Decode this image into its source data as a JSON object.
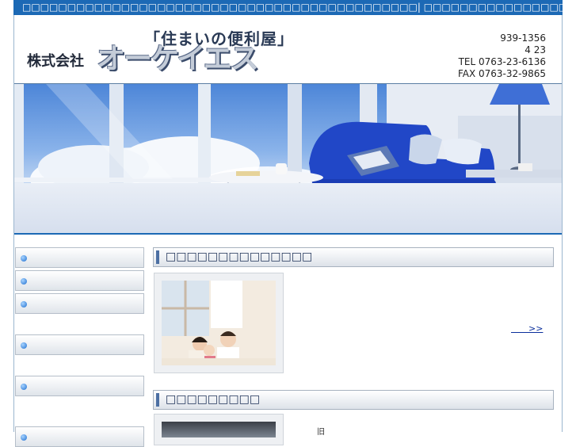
{
  "topbar": {
    "text": "□□□□□□□□□□□□□□□□□□□□□□□□□□□□□□□□□□□□□□□□□□□□| □□□□□□□□□□□□□□□□□□□□□□□□□□□□□"
  },
  "header": {
    "tagline": "「住まいの便利屋」",
    "company_prefix": "株式会社",
    "company_name": "オーケイエス",
    "contact": {
      "postal": "939-1356",
      "address_num": "4 23",
      "tel": "TEL 0763-23-6136",
      "fax": "FAX 0763-32-9865"
    }
  },
  "sidebar": {
    "items": [
      {
        "label": ""
      },
      {
        "label": ""
      },
      {
        "label": ""
      },
      {
        "label": ""
      },
      {
        "label": ""
      },
      {
        "label": ""
      }
    ]
  },
  "main": {
    "sections": [
      {
        "title": "□□□□□□□□□□□□□□",
        "more_link": "　　>>"
      },
      {
        "title": "□□□□□□□□□"
      }
    ],
    "fragment_text": "旧"
  },
  "colors": {
    "accent": "#1c69b5",
    "link": "#0b2f9c"
  }
}
